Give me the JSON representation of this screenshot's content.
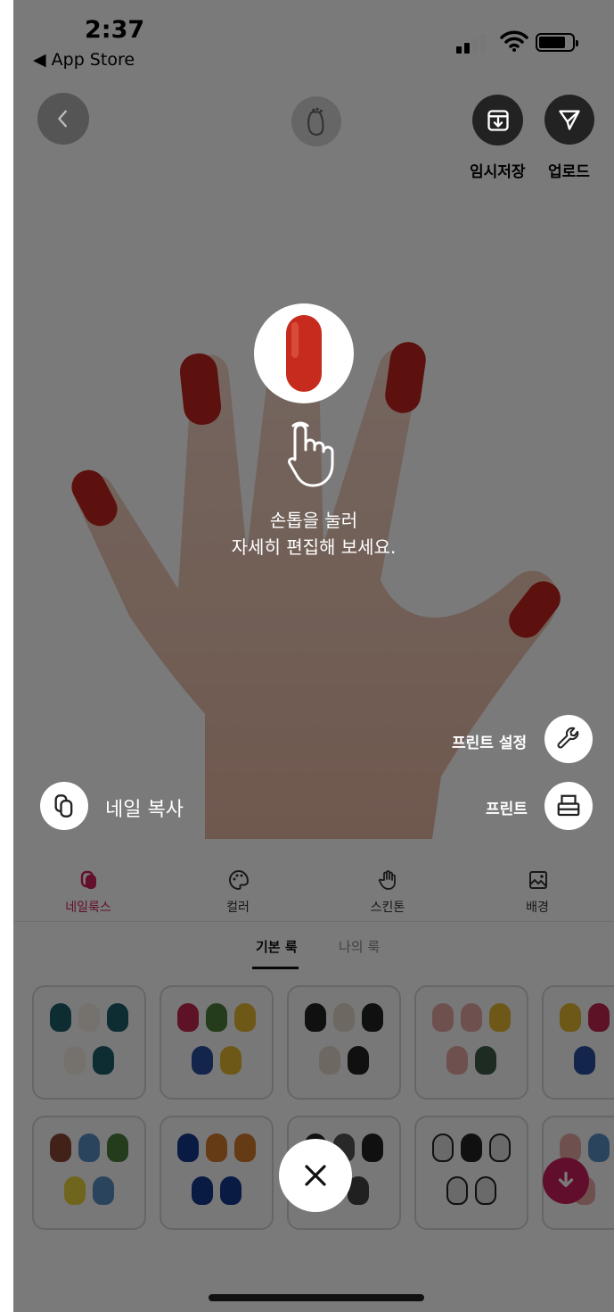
{
  "status_bar": {
    "time": "2:37",
    "back_app": "◀ App Store"
  },
  "top_actions": {
    "save_label": "임시저장",
    "upload_label": "업로드"
  },
  "hint": {
    "line1": "손톱을 눌러",
    "line2": "자세히 편집해 보세요."
  },
  "tools": {
    "print_settings_label": "프린트 설정",
    "print_label": "프린트",
    "copy_label": "네일 복사"
  },
  "tabs": [
    {
      "label": "네일룩스",
      "icon": "nail-looks-icon",
      "active": true
    },
    {
      "label": "컬러",
      "icon": "palette-icon",
      "active": false
    },
    {
      "label": "스킨톤",
      "icon": "hand-icon",
      "active": false
    },
    {
      "label": "배경",
      "icon": "image-icon",
      "active": false
    }
  ],
  "sub_tabs": [
    {
      "label": "기본 룩",
      "active": true
    },
    {
      "label": "나의 룩",
      "active": false
    }
  ],
  "colors": {
    "accent": "#d2215a",
    "nail_red": "#c0241e",
    "overlay": "rgba(0,0,0,0.52)",
    "download": "#c81e5b"
  }
}
